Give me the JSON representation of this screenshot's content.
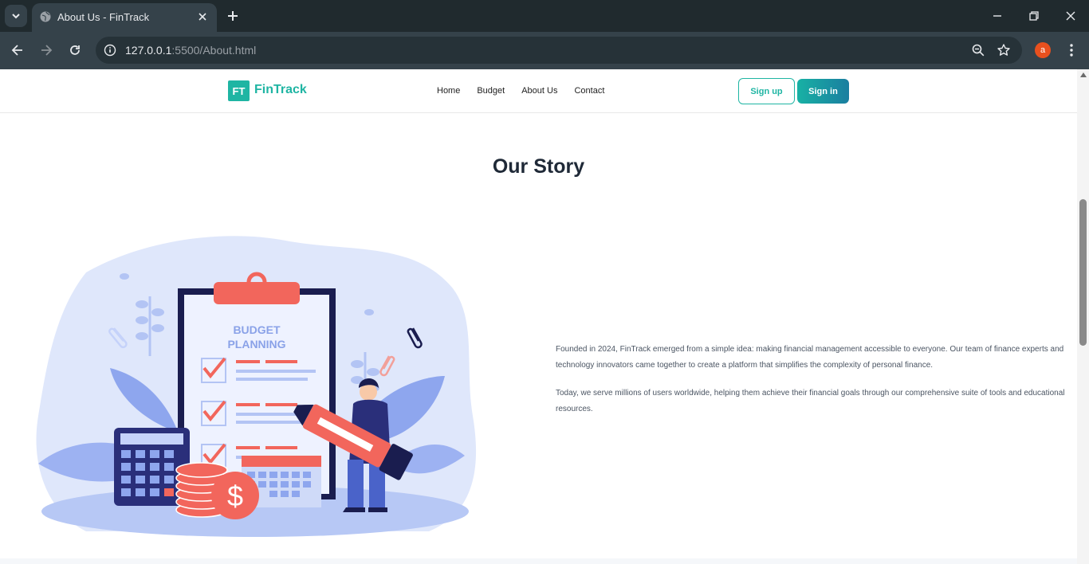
{
  "browser": {
    "tab_title": "About Us - FinTrack",
    "url_host": "127.0.0.1",
    "url_rest": ":5500/About.html",
    "profile_initial": "a"
  },
  "header": {
    "logo_mark": "FT",
    "logo_text": "FinTrack",
    "nav": [
      "Home",
      "Budget",
      "About Us",
      "Contact"
    ],
    "signup_label": "Sign up",
    "signin_label": "Sign in"
  },
  "story": {
    "title": "Our Story",
    "paragraphs": [
      "Founded in 2024, FinTrack emerged from a simple idea: making financial management accessible to everyone. Our team of finance experts and technology innovators came together to create a platform that simplifies the complexity of personal finance.",
      "Today, we serve millions of users worldwide, helping them achieve their financial goals through our comprehensive suite of tools and educational resources."
    ],
    "illustration": {
      "heading_line1": "BUDGET",
      "heading_line2": "PLANNING",
      "coin_symbol": "$"
    }
  },
  "colors": {
    "brand": "#1fb5a3",
    "accent_red": "#f2665c",
    "illustration_bg": "#dfe7fb"
  }
}
